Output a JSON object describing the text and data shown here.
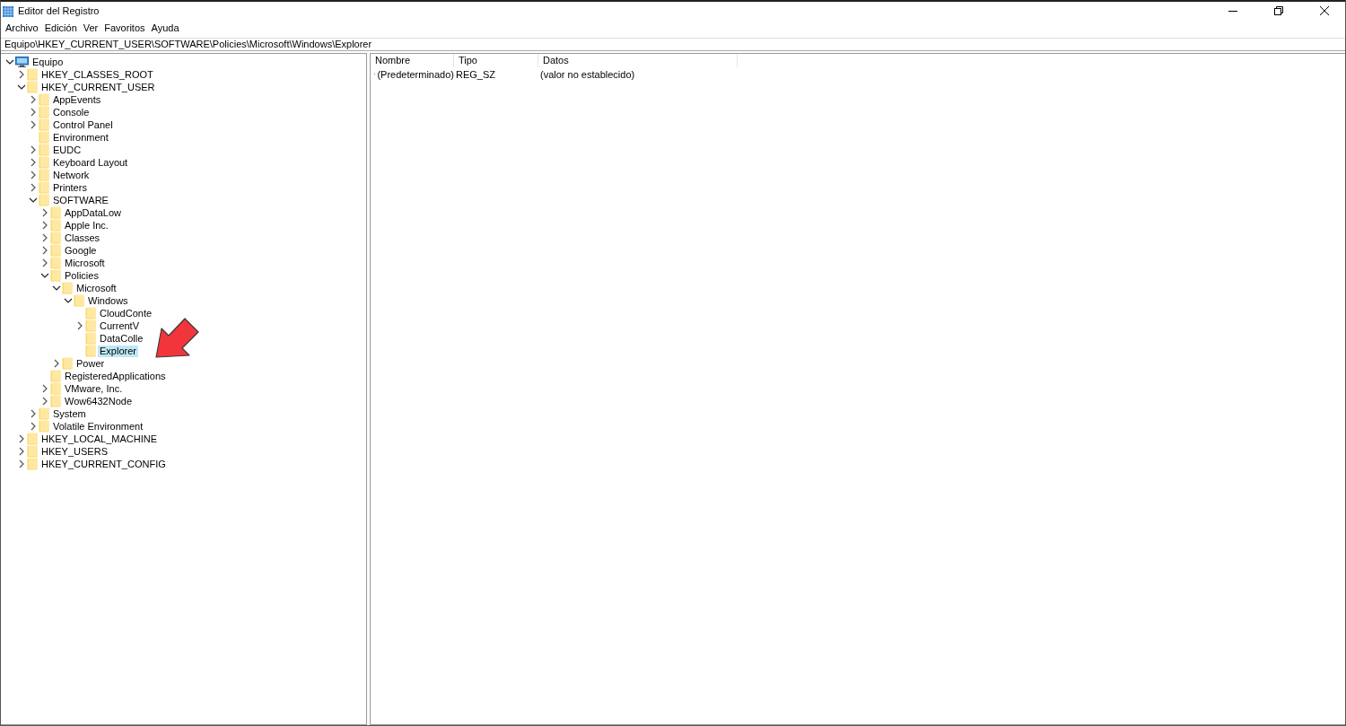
{
  "window": {
    "title": "Editor del Registro"
  },
  "menu": [
    "Archivo",
    "Edición",
    "Ver",
    "Favoritos",
    "Ayuda"
  ],
  "address": "Equipo\\HKEY_CURRENT_USER\\SOFTWARE\\Policies\\Microsoft\\Windows\\Explorer",
  "tree": [
    {
      "label": "Equipo",
      "kind": "computer",
      "expanded": true,
      "selected": false,
      "children": [
        {
          "label": "HKEY_CLASSES_ROOT",
          "kind": "key",
          "expanded": false,
          "selected": false
        },
        {
          "label": "HKEY_CURRENT_USER",
          "kind": "key",
          "expanded": true,
          "selected": false,
          "children": [
            {
              "label": "AppEvents",
              "kind": "key",
              "expanded": false,
              "selected": false
            },
            {
              "label": "Console",
              "kind": "key",
              "expanded": false,
              "selected": false
            },
            {
              "label": "Control Panel",
              "kind": "key",
              "expanded": false,
              "selected": false
            },
            {
              "label": "Environment",
              "kind": "leaf",
              "selected": false
            },
            {
              "label": "EUDC",
              "kind": "key",
              "expanded": false,
              "selected": false
            },
            {
              "label": "Keyboard Layout",
              "kind": "key",
              "expanded": false,
              "selected": false
            },
            {
              "label": "Network",
              "kind": "key",
              "expanded": false,
              "selected": false
            },
            {
              "label": "Printers",
              "kind": "key",
              "expanded": false,
              "selected": false
            },
            {
              "label": "SOFTWARE",
              "kind": "key",
              "expanded": true,
              "selected": false,
              "children": [
                {
                  "label": "AppDataLow",
                  "kind": "key",
                  "expanded": false,
                  "selected": false
                },
                {
                  "label": "Apple Inc.",
                  "kind": "key",
                  "expanded": false,
                  "selected": false
                },
                {
                  "label": "Classes",
                  "kind": "key",
                  "expanded": false,
                  "selected": false
                },
                {
                  "label": "Google",
                  "kind": "key",
                  "expanded": false,
                  "selected": false
                },
                {
                  "label": "Microsoft",
                  "kind": "key",
                  "expanded": false,
                  "selected": false
                },
                {
                  "label": "Policies",
                  "kind": "key",
                  "expanded": true,
                  "selected": false,
                  "children": [
                    {
                      "label": "Microsoft",
                      "kind": "key",
                      "expanded": true,
                      "selected": false,
                      "children": [
                        {
                          "label": "Windows",
                          "kind": "key",
                          "expanded": true,
                          "selected": false,
                          "children": [
                            {
                              "label": "CloudConte",
                              "kind": "leaf",
                              "selected": false
                            },
                            {
                              "label": "CurrentV",
                              "kind": "key",
                              "expanded": false,
                              "selected": false
                            },
                            {
                              "label": "DataColle",
                              "kind": "leaf",
                              "selected": false
                            },
                            {
                              "label": "Explorer",
                              "kind": "leaf",
                              "selected": true
                            }
                          ]
                        }
                      ]
                    },
                    {
                      "label": "Power",
                      "kind": "key",
                      "expanded": false,
                      "selected": false
                    }
                  ]
                },
                {
                  "label": "RegisteredApplications",
                  "kind": "leaf",
                  "selected": false
                },
                {
                  "label": "VMware, Inc.",
                  "kind": "key",
                  "expanded": false,
                  "selected": false
                },
                {
                  "label": "Wow6432Node",
                  "kind": "key",
                  "expanded": false,
                  "selected": false
                }
              ]
            },
            {
              "label": "System",
              "kind": "key",
              "expanded": false,
              "selected": false
            },
            {
              "label": "Volatile Environment",
              "kind": "key",
              "expanded": false,
              "selected": false
            }
          ]
        },
        {
          "label": "HKEY_LOCAL_MACHINE",
          "kind": "key",
          "expanded": false,
          "selected": false
        },
        {
          "label": "HKEY_USERS",
          "kind": "key",
          "expanded": false,
          "selected": false
        },
        {
          "label": "HKEY_CURRENT_CONFIG",
          "kind": "key",
          "expanded": false,
          "selected": false
        }
      ]
    }
  ],
  "table": {
    "columns": [
      "Nombre",
      "Tipo",
      "Datos"
    ],
    "rows": [
      {
        "name": "(Predeterminado)",
        "type": "REG_SZ",
        "data": "(valor no establecido)"
      }
    ]
  }
}
